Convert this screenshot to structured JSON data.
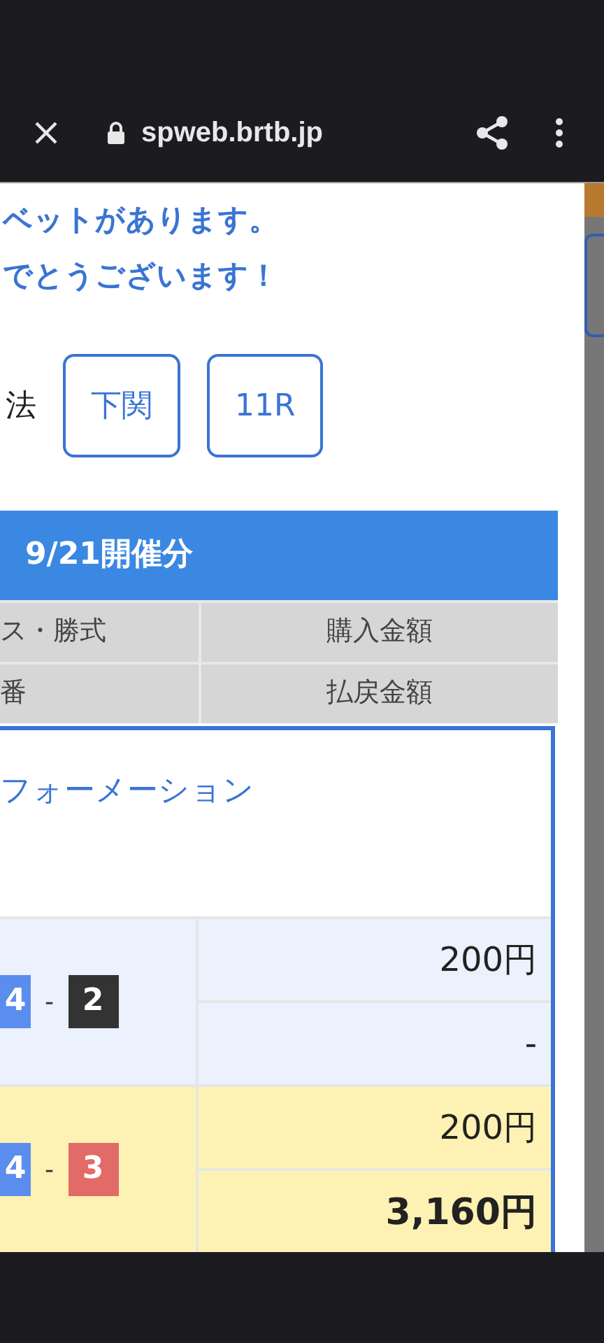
{
  "browser": {
    "url": "spweb.brtb.jp"
  },
  "message": [
    "ベットがあります。",
    "でとうございます！"
  ],
  "filter": {
    "label": "法",
    "buttons": [
      "下関",
      "11R"
    ]
  },
  "table": {
    "title": "9/21開催分",
    "header": [
      [
        "ス・勝式",
        "購入金額"
      ],
      [
        "番",
        "払戻金額"
      ]
    ],
    "bet_type": "フォーメーション",
    "rows": [
      {
        "won": false,
        "combo": [
          {
            "kind": "boat",
            "text": "4",
            "color": "#5b8def"
          },
          {
            "kind": "dash",
            "text": "-"
          },
          {
            "kind": "boat",
            "text": "2",
            "color": "#333333"
          }
        ],
        "stake": "200円",
        "payout": "-"
      },
      {
        "won": true,
        "combo": [
          {
            "kind": "boat",
            "text": "4",
            "color": "#5b8def"
          },
          {
            "kind": "dash",
            "text": "-"
          },
          {
            "kind": "boat",
            "text": "3",
            "color": "#e26b67"
          }
        ],
        "stake": "200円",
        "payout": "3,160円"
      }
    ]
  }
}
